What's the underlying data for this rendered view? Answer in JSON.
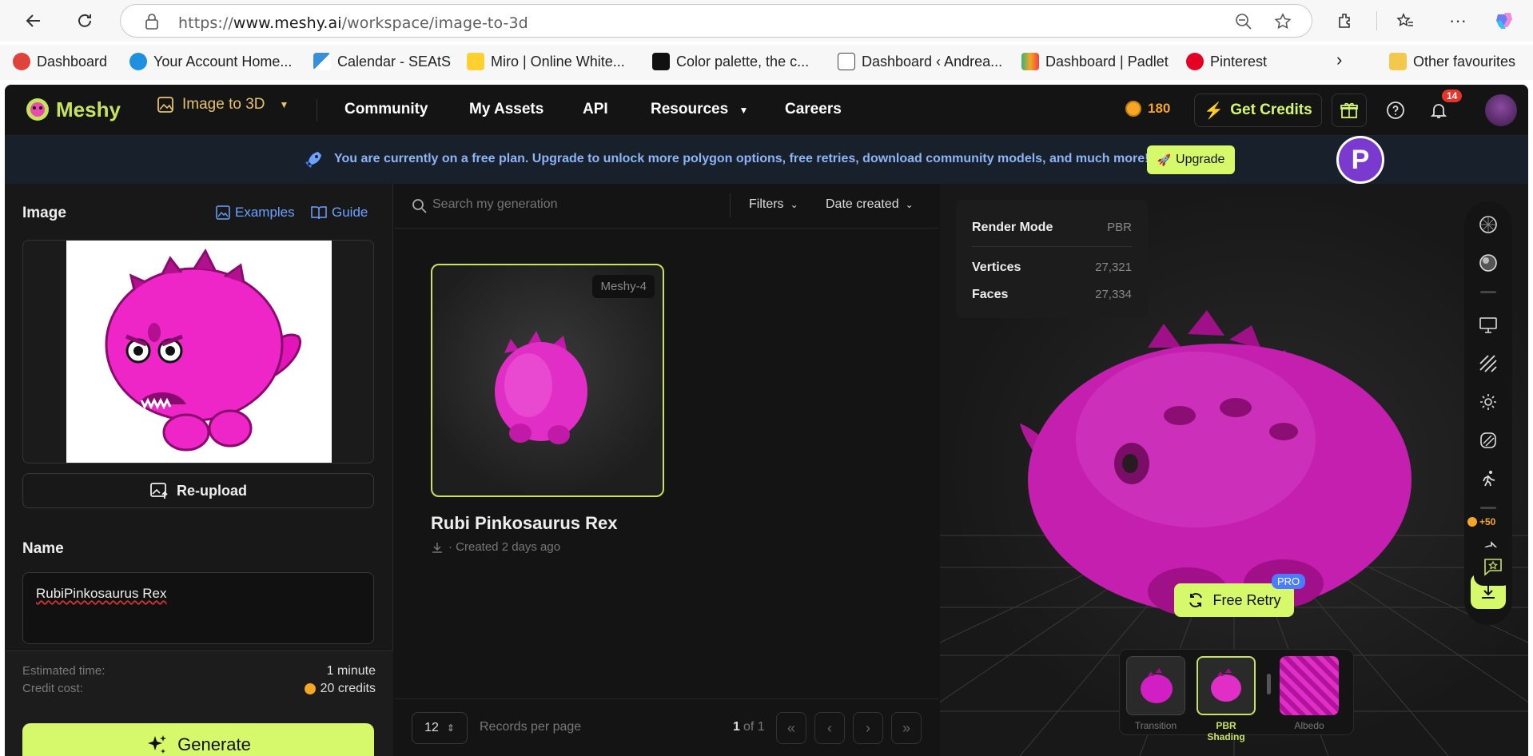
{
  "browser": {
    "url_prefix": "https://",
    "url_host": "www.meshy.ai",
    "url_path": "/workspace/image-to-3d",
    "bookmarks": [
      "Dashboard",
      "Your Account Home...",
      "Calendar - SEAtS",
      "Miro | Online White...",
      "Color palette, the c...",
      "Dashboard ‹ Andrea...",
      "Dashboard | Padlet",
      "Pinterest",
      "Other favourites"
    ]
  },
  "nav": {
    "brand": "Meshy",
    "mode": "Image to 3D",
    "items": [
      "Community",
      "My Assets",
      "API",
      "Resources",
      "Careers"
    ],
    "credits": "180",
    "get_credits": "Get Credits",
    "notifications": "14"
  },
  "banner": {
    "text": "You are currently on a free plan. Upgrade to unlock more polygon options, free retries, download community models, and much more!",
    "upgrade": "Upgrade"
  },
  "left": {
    "image_label": "Image",
    "examples": "Examples",
    "guide": "Guide",
    "reupload": "Re-upload",
    "name_label": "Name",
    "name_value": "RubiPinkosaurus Rex",
    "estimated_time_label": "Estimated time:",
    "estimated_time": "1 minute",
    "credit_cost_label": "Credit cost:",
    "credit_cost": "20 credits",
    "generate": "Generate"
  },
  "middle": {
    "search_placeholder": "Search my generation",
    "filters": "Filters",
    "sort": "Date created",
    "card": {
      "badge": "Meshy-4",
      "title": "Rubi Pinkosaurus Rex",
      "subtitle": "· Created 2 days ago"
    },
    "per_page": "12",
    "per_page_label": "Records per page",
    "page": "1",
    "of_pages": "of 1"
  },
  "viewer": {
    "render_mode_label": "Render Mode",
    "render_mode": "PBR",
    "vertices_label": "Vertices",
    "vertices": "27,321",
    "faces_label": "Faces",
    "faces": "27,334",
    "bonus": "+50",
    "retry": "Free Retry",
    "pro": "PRO",
    "thumbs": [
      "Transition",
      "PBR Shading",
      "Albedo"
    ]
  },
  "colors": {
    "accent": "#d6f86b",
    "link": "#6ca2ff",
    "model_pink": "#d21fc4",
    "badge_red": "#e5352b"
  }
}
